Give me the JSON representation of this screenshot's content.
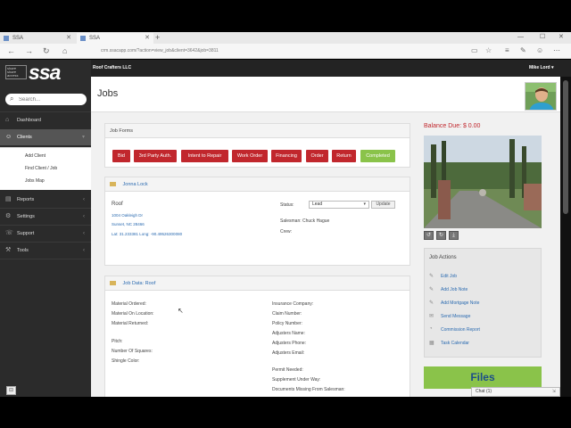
{
  "browser": {
    "tabs": [
      {
        "label": "SSA"
      },
      {
        "label": "SSA"
      }
    ],
    "new_tab": "+",
    "url": "crm.ssacapp.com/?action=view_job&client=3642&job=3811",
    "window_controls": [
      "—",
      "☐",
      "✕"
    ]
  },
  "app": {
    "company": "Roof Crafters LLC",
    "user": "Mike Lord ▾"
  },
  "logo": {
    "small": "share share access",
    "big": "ssa"
  },
  "sidebar": {
    "search_placeholder": "Search...",
    "items": [
      {
        "label": "Dashboard",
        "icon": "dashboard-icon"
      },
      {
        "label": "Clients",
        "icon": "users-icon",
        "active": true
      },
      {
        "label": "Reports",
        "icon": "reports-icon"
      },
      {
        "label": "Settings",
        "icon": "gear-icon"
      },
      {
        "label": "Support",
        "icon": "support-icon"
      },
      {
        "label": "Tools",
        "icon": "wrench-icon"
      }
    ],
    "clients_sub": [
      "Add Client",
      "Find Client / Job",
      "Jobs Map"
    ]
  },
  "page": {
    "title": "Jobs"
  },
  "job_forms": {
    "title": "Job Forms",
    "buttons": [
      {
        "label": "Bid"
      },
      {
        "label": "3rd Party Auth."
      },
      {
        "label": "Intent to Repair"
      },
      {
        "label": "Work Order"
      },
      {
        "label": "Financing"
      },
      {
        "label": "Order"
      },
      {
        "label": "Return"
      },
      {
        "label": "Completed"
      }
    ]
  },
  "client": {
    "name": "Jonna Lock",
    "job_type": "Roof",
    "address_line1": "1004 Oakleigh Dr",
    "address_line2": "Sunset, NC 28466",
    "coords": "Lat: 31.233381 Long: -90.49526300080",
    "status_label": "Status:",
    "status_value": "Lead",
    "update_label": "Update",
    "salesman": "Salesman: Chuck Hague",
    "crew": "Crew:"
  },
  "job_data": {
    "title": "Job Data: Roof",
    "left": [
      "Material Ordered:",
      "Material On Location:",
      "Material Returned:",
      "Pitch:",
      "Number Of Squares:",
      "Shingle Color:"
    ],
    "right": [
      "Insurance Company:",
      "Claim Number:",
      "Policy Number:",
      "Adjusters Name:",
      "Adjusters Phone:",
      "Adjusters Email:",
      "Permit Needed:",
      "Supplement Under Way:",
      "Documents Missing From Salesman:"
    ]
  },
  "right_panel": {
    "balance": "Balance Due: $ 0.00",
    "job_actions_title": "Job Actions",
    "actions": [
      {
        "label": "Edit Job",
        "icon": "pencil-icon"
      },
      {
        "label": "Add Job Note",
        "icon": "note-icon"
      },
      {
        "label": "Add Mortgage Note",
        "icon": "note-icon"
      },
      {
        "label": "Send Message",
        "icon": "envelope-icon"
      },
      {
        "label": "Commission Report",
        "icon": "report-icon"
      },
      {
        "label": "Task Calendar",
        "icon": "calendar-icon"
      }
    ],
    "files": "Files"
  },
  "chat": {
    "label": "Chat (1)"
  },
  "colors": {
    "brand_red": "#c1272d",
    "green": "#8ac34a",
    "link_blue": "#2a6ab0",
    "sidebar_bg": "#2b2b2b"
  }
}
